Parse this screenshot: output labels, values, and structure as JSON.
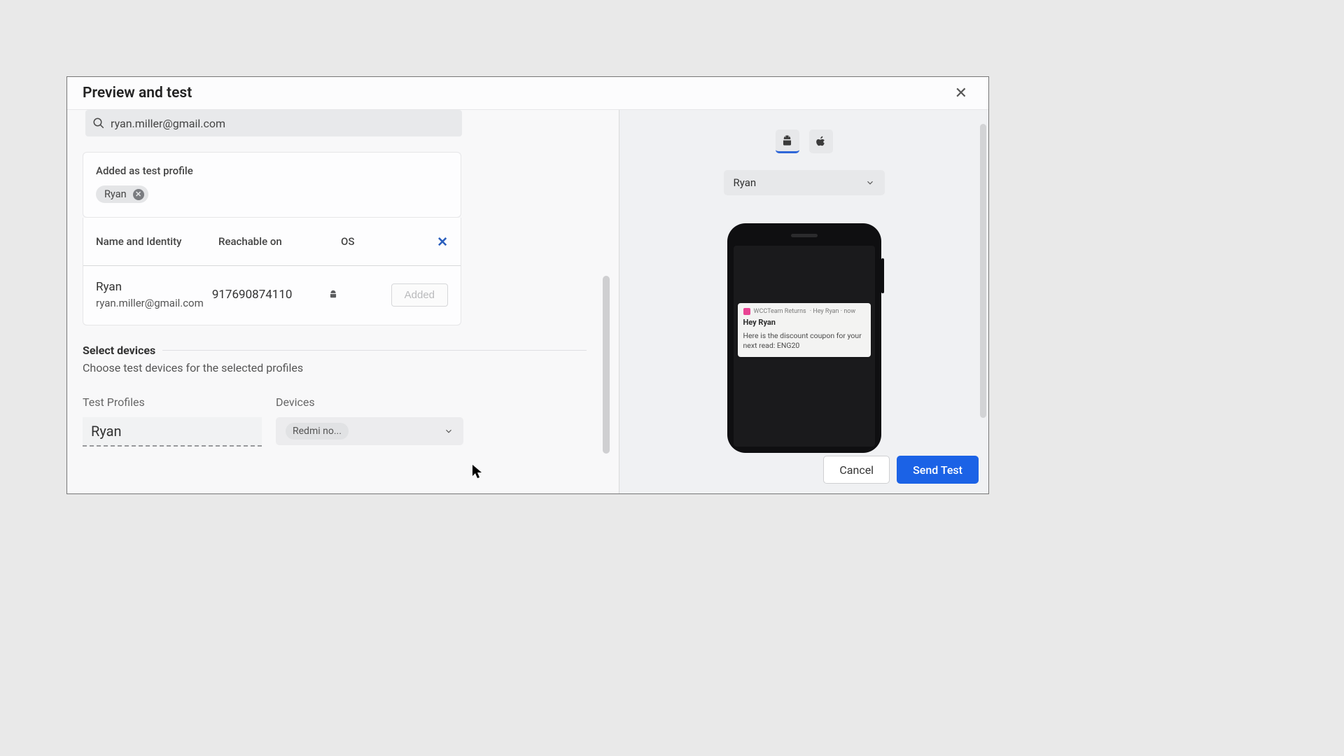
{
  "header": {
    "title": "Preview and test"
  },
  "search": {
    "value": "ryan.miller@gmail.com"
  },
  "addedProfileCard": {
    "label": "Added as test profile",
    "chip": "Ryan"
  },
  "table": {
    "headers": {
      "name": "Name and Identity",
      "reachable": "Reachable on",
      "os": "OS"
    },
    "rows": [
      {
        "name": "Ryan",
        "identity": "ryan.miller@gmail.com",
        "reachable": "917690874110",
        "os_icon": "android",
        "action": "Added"
      }
    ]
  },
  "selectDevices": {
    "title": "Select devices",
    "subtitle": "Choose test devices for the selected profiles",
    "testProfilesLabel": "Test Profiles",
    "devicesLabel": "Devices",
    "profileValue": "Ryan",
    "deviceValue": "Redmi no..."
  },
  "preview": {
    "platforms": {
      "android": true,
      "ios": false
    },
    "profileSelect": "Ryan",
    "notification": {
      "app": "WCCTeam Returns",
      "subline": "· Hey Ryan · now",
      "title": "Hey Ryan",
      "body": "Here is the discount coupon for your next read: ENG20"
    }
  },
  "footer": {
    "cancel": "Cancel",
    "send": "Send Test"
  }
}
